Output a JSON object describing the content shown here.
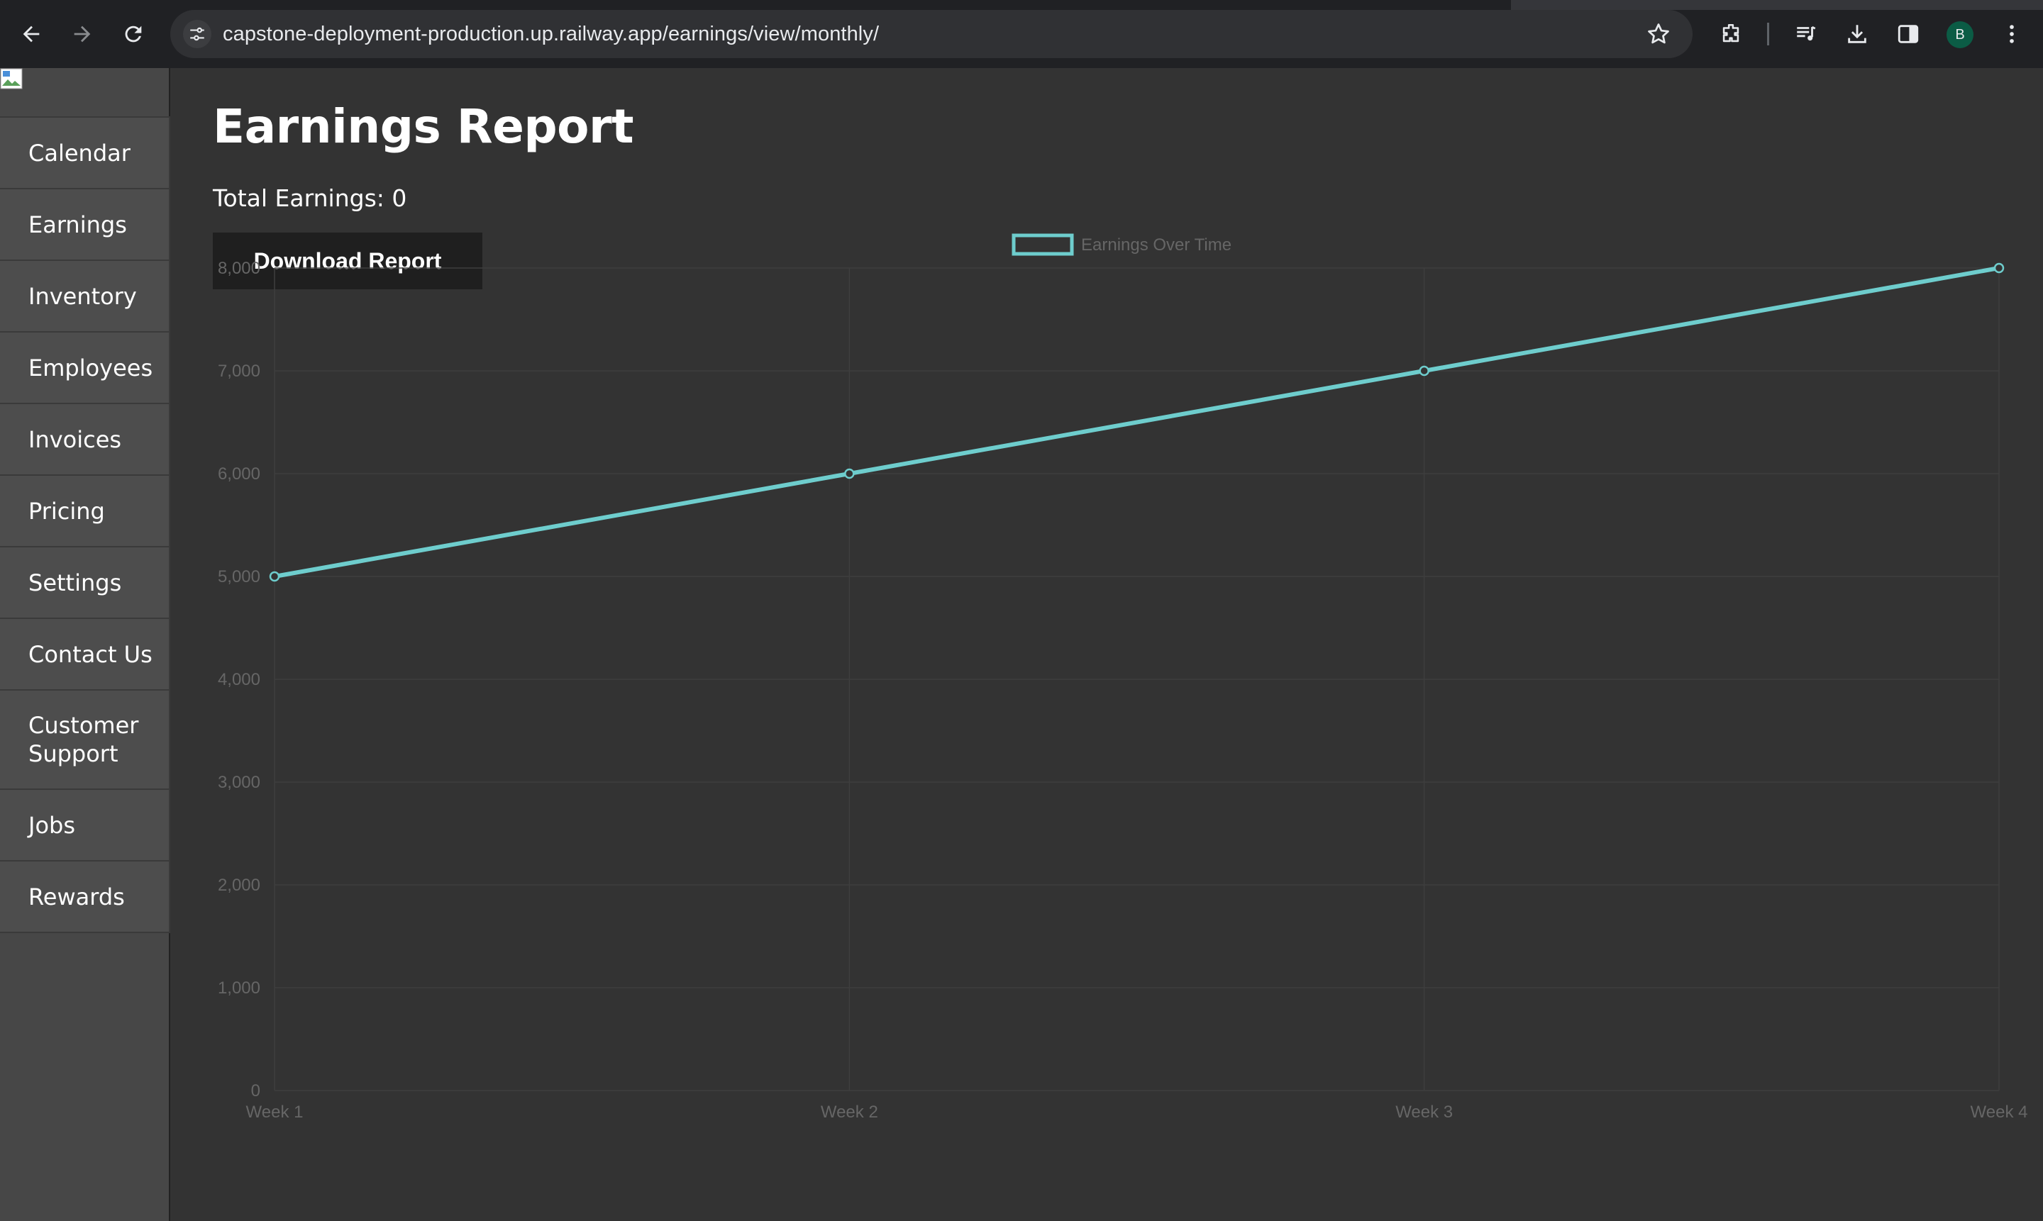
{
  "browser": {
    "url_host": "capstone-deployment-production.up.railway.app",
    "url_path": "/earnings/view/monthly/",
    "profile_initial": "B"
  },
  "sidebar": {
    "items": [
      {
        "label": "Calendar"
      },
      {
        "label": "Earnings"
      },
      {
        "label": "Inventory"
      },
      {
        "label": "Employees"
      },
      {
        "label": "Invoices"
      },
      {
        "label": "Pricing"
      },
      {
        "label": "Settings"
      },
      {
        "label": "Contact Us"
      },
      {
        "label": "Customer Support"
      },
      {
        "label": "Jobs"
      },
      {
        "label": "Rewards"
      }
    ]
  },
  "main": {
    "title": "Earnings Report",
    "total_label": "Total Earnings: 0",
    "download_label": "Download Report"
  },
  "colors": {
    "line": "#6ecdcd",
    "background": "#333333",
    "sidebar": "#474747"
  },
  "chart_data": {
    "type": "line",
    "categories": [
      "Week 1",
      "Week 2",
      "Week 3",
      "Week 4"
    ],
    "series": [
      {
        "name": "Earnings Over Time",
        "values": [
          5000,
          6000,
          7000,
          8000
        ]
      }
    ],
    "ylim": [
      0,
      8000
    ],
    "yticks": [
      "0",
      "1,000",
      "2,000",
      "3,000",
      "4,000",
      "5,000",
      "6,000",
      "7,000",
      "8,000"
    ],
    "legend": "top-center",
    "grid": true
  }
}
